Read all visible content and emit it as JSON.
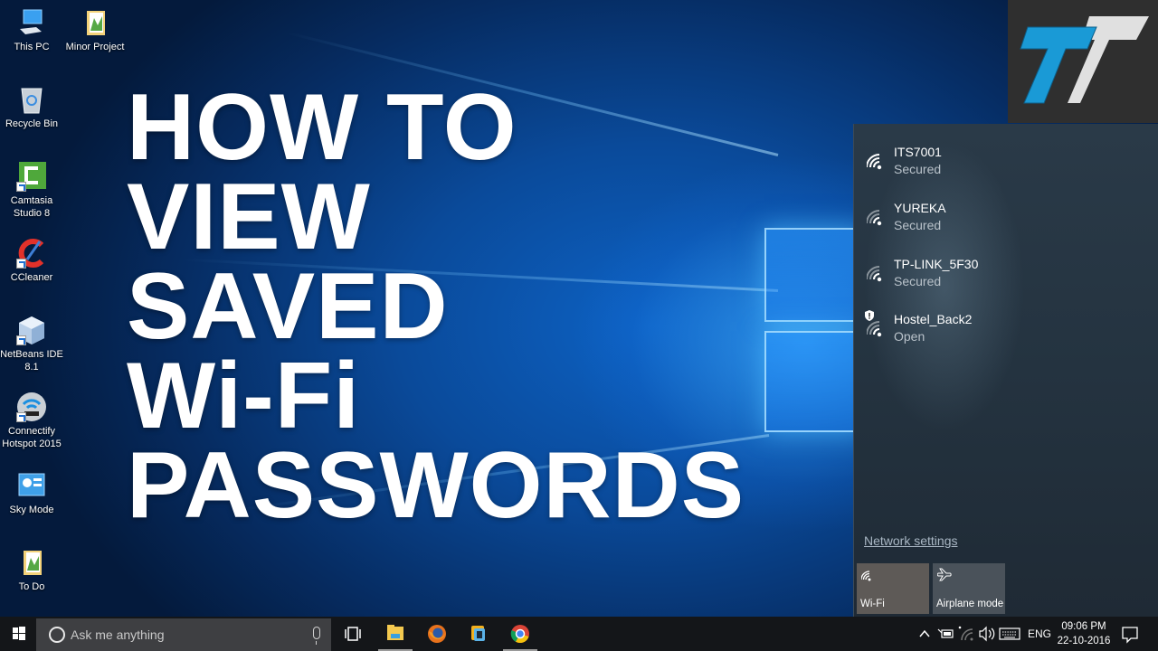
{
  "desktop": {
    "icons": [
      {
        "label": "This PC",
        "icon": "computer-icon"
      },
      {
        "label": "Minor Project",
        "icon": "folder-icon"
      },
      {
        "label": "Recycle Bin",
        "icon": "recycle-bin-icon"
      },
      {
        "label": "Camtasia Studio 8",
        "icon": "camtasia-icon"
      },
      {
        "label": "CCleaner",
        "icon": "ccleaner-icon"
      },
      {
        "label": "NetBeans IDE 8.1",
        "icon": "netbeans-icon"
      },
      {
        "label": "Connectify Hotspot 2015",
        "icon": "connectify-icon"
      },
      {
        "label": "Sky Mode",
        "icon": "sky-mode-icon"
      },
      {
        "label": "To Do",
        "icon": "folder-icon"
      }
    ]
  },
  "headline": {
    "lines": [
      "HOW TO",
      "VIEW",
      "SAVED",
      "Wi-Fi",
      "PASSWORDS"
    ]
  },
  "network_flyout": {
    "networks": [
      {
        "ssid": "ITS7001",
        "status": "Secured",
        "signal": "full",
        "warning": false
      },
      {
        "ssid": "YUREKA",
        "status": "Secured",
        "signal": "medium",
        "warning": false
      },
      {
        "ssid": "TP-LINK_5F30",
        "status": "Secured",
        "signal": "medium",
        "warning": false
      },
      {
        "ssid": "Hostel_Back2",
        "status": "Open",
        "signal": "medium",
        "warning": true
      }
    ],
    "network_settings_label": "Network settings",
    "quick_actions": [
      {
        "label": "Wi-Fi",
        "icon": "wifi-icon",
        "active": true
      },
      {
        "label": "Airplane mode",
        "icon": "airplane-icon",
        "active": false
      }
    ]
  },
  "taskbar": {
    "search_placeholder": "Ask me anything",
    "pinned": [
      "Task View",
      "File Explorer",
      "Firefox",
      "VMware",
      "Chrome"
    ],
    "tray": {
      "language": "ENG",
      "time": "09:06 PM",
      "date": "22-10-2016"
    }
  },
  "colors": {
    "accent_blue": "#1a9ad6",
    "flyout_bg": "#26343f",
    "taskbar_bg": "#141619"
  }
}
